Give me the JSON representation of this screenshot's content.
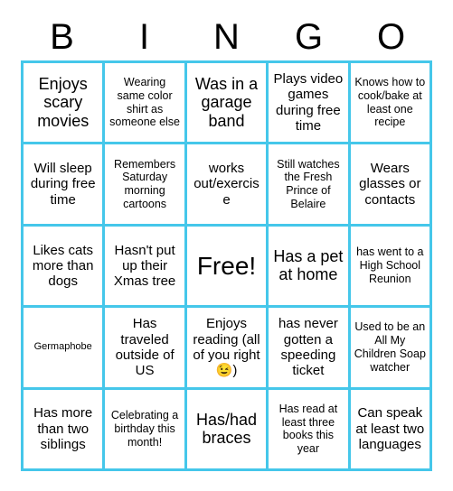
{
  "header": {
    "letters": [
      "B",
      "I",
      "N",
      "G",
      "O"
    ]
  },
  "colors": {
    "grid_border": "#45c7ea",
    "cell_background": "#ffffff",
    "text": "#000000",
    "page_background": "#ffffff"
  },
  "grid": {
    "rows": 5,
    "columns": 5,
    "cells": [
      {
        "text": "Enjoys scary movies",
        "size": "lg"
      },
      {
        "text": "Wearing same color shirt as someone else",
        "size": "sm"
      },
      {
        "text": "Was in a garage band",
        "size": "lg"
      },
      {
        "text": "Plays video games during free time",
        "size": "md"
      },
      {
        "text": "Knows how to cook/bake at least one recipe",
        "size": "sm"
      },
      {
        "text": "Will sleep during free time",
        "size": "md"
      },
      {
        "text": "Remembers Saturday morning cartoons",
        "size": "sm"
      },
      {
        "text": "works out/exercise",
        "size": "md"
      },
      {
        "text": "Still watches the Fresh Prince of Belaire",
        "size": "sm"
      },
      {
        "text": "Wears glasses or contacts",
        "size": "md"
      },
      {
        "text": "Likes cats more than dogs",
        "size": "md"
      },
      {
        "text": "Hasn't put up their Xmas tree",
        "size": "md"
      },
      {
        "text": "Free!",
        "size": "xl"
      },
      {
        "text": "Has a pet at home",
        "size": "lg"
      },
      {
        "text": "has went to a High School Reunion",
        "size": "sm"
      },
      {
        "text": "Germaphobe",
        "size": "xs"
      },
      {
        "text": "Has traveled outside of US",
        "size": "md"
      },
      {
        "text": "Enjoys reading (all of you right 😉)",
        "size": "md"
      },
      {
        "text": "has never gotten a speeding ticket",
        "size": "md"
      },
      {
        "text": "Used to be an All My Children Soap watcher",
        "size": "sm"
      },
      {
        "text": "Has more than two siblings",
        "size": "md"
      },
      {
        "text": "Celebrating a birthday this month!",
        "size": "sm"
      },
      {
        "text": "Has/had braces",
        "size": "lg"
      },
      {
        "text": "Has read at least three books this year",
        "size": "sm"
      },
      {
        "text": "Can speak at least two languages",
        "size": "md"
      }
    ]
  }
}
